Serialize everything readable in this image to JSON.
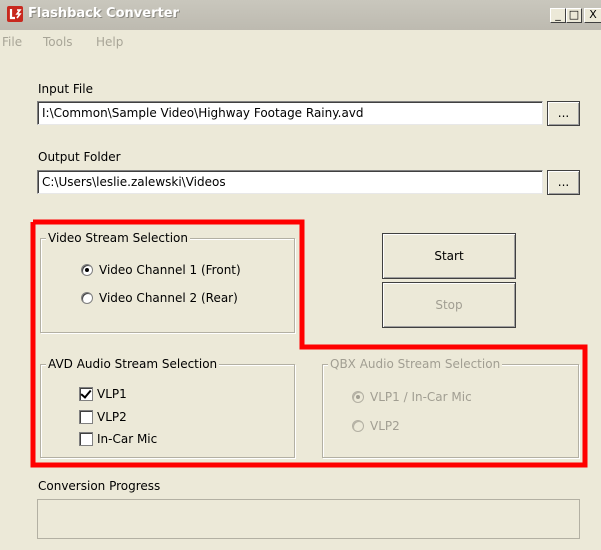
{
  "window": {
    "title": "Flashback Converter",
    "controls": {
      "minimize": "_",
      "maximize": "□",
      "close": "X"
    }
  },
  "menu": {
    "items": [
      "File",
      "Tools",
      "Help"
    ]
  },
  "input_file": {
    "label": "Input File",
    "value": "I:\\Common\\Sample Video\\Highway Footage Rainy.avd",
    "browse_label": "..."
  },
  "output_folder": {
    "label": "Output Folder",
    "value": "C:\\Users\\leslie.zalewski\\Videos",
    "browse_label": "..."
  },
  "video_stream": {
    "title": "Video Stream Selection",
    "options": [
      {
        "label": "Video Channel 1 (Front)",
        "selected": true
      },
      {
        "label": "Video Channel 2 (Rear)",
        "selected": false
      }
    ]
  },
  "buttons": {
    "start": "Start",
    "stop": "Stop",
    "stop_enabled": false
  },
  "avd_audio": {
    "title": "AVD Audio Stream Selection",
    "options": [
      {
        "label": "VLP1",
        "checked": true
      },
      {
        "label": "VLP2",
        "checked": false
      },
      {
        "label": "In-Car Mic",
        "checked": false
      }
    ]
  },
  "qbx_audio": {
    "title": "QBX Audio Stream Selection",
    "enabled": false,
    "options": [
      {
        "label": "VLP1 / In-Car Mic",
        "selected": true
      },
      {
        "label": "VLP2",
        "selected": false
      }
    ]
  },
  "progress": {
    "label": "Conversion Progress",
    "value": 0
  },
  "colors": {
    "window_bg": "#ece9d8",
    "highlight": "#ff0000",
    "disabled_text": "#a19e92"
  }
}
